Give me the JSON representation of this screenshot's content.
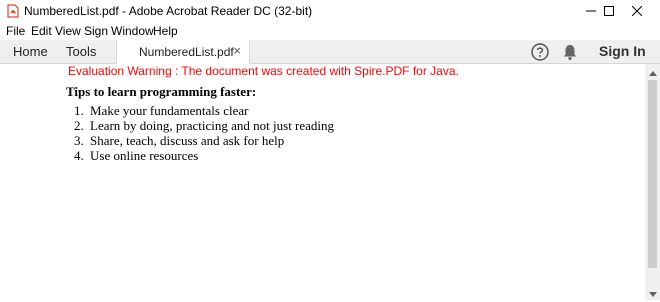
{
  "window": {
    "title": "NumberedList.pdf - Adobe Acrobat Reader DC (32-bit)"
  },
  "menu": [
    "File",
    "Edit",
    "View",
    "Sign",
    "Window",
    "Help"
  ],
  "toolbar": {
    "home": "Home",
    "tools": "Tools",
    "doc_tab": "NumberedList.pdf",
    "close_glyph": "×",
    "sign_in": "Sign In"
  },
  "document": {
    "warning": "Evaluation Warning : The document was created with Spire.PDF for Java.",
    "heading": "Tips to learn programming faster:",
    "items": [
      {
        "num": "1.",
        "text": "Make your fundamentals clear"
      },
      {
        "num": "2.",
        "text": "Learn by doing, practicing and not just reading"
      },
      {
        "num": "3.",
        "text": "Share, teach, discuss and ask for help"
      },
      {
        "num": "4.",
        "text": "Use online resources"
      }
    ]
  },
  "colors": {
    "warning": "#ff0000",
    "acrobat_red": "#d81e05",
    "tabbar_bg": "#efefef"
  },
  "icons": [
    "acrobat-pdf-icon",
    "minimize-icon",
    "maximize-icon",
    "close-icon",
    "help-icon",
    "bell-icon",
    "scroll-up-icon",
    "scroll-down-icon"
  ]
}
